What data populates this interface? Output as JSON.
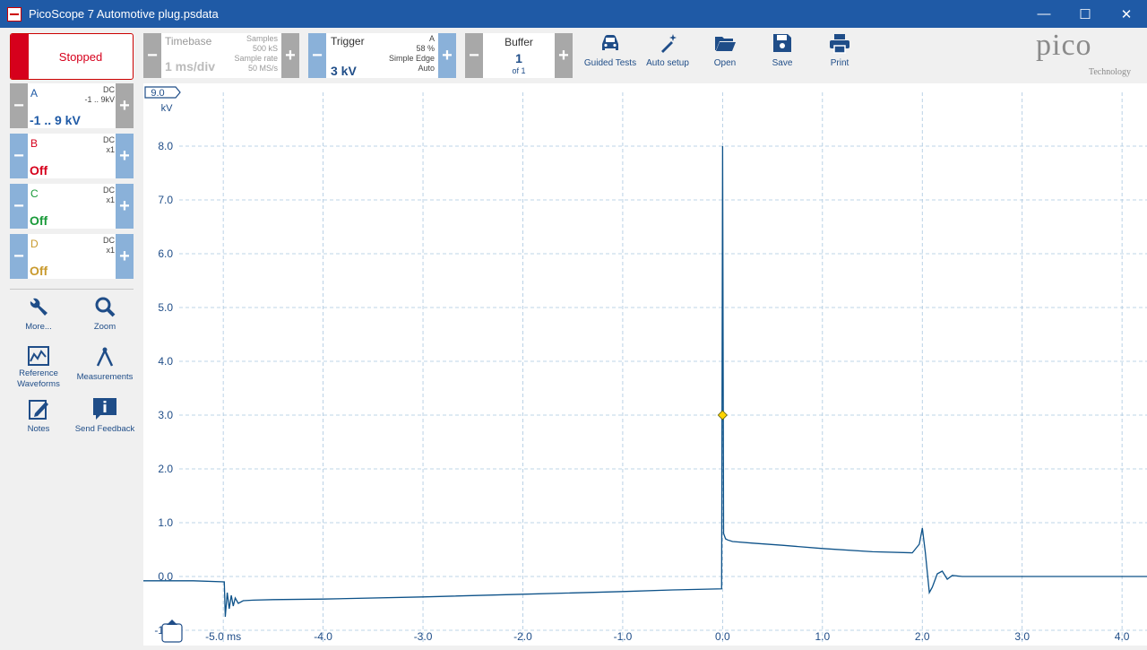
{
  "window": {
    "title": "PicoScope 7 Automotive plug.psdata",
    "minimize": "—",
    "maximize": "☐",
    "close": "✕"
  },
  "toolbar": {
    "run_state": "Stopped",
    "timebase": {
      "label": "Timebase",
      "value": "1 ms/div",
      "samples_label": "Samples",
      "samples": "500 kS",
      "rate_label": "Sample rate",
      "rate": "50 MS/s",
      "minus": "−",
      "plus": "+"
    },
    "trigger": {
      "label": "Trigger",
      "value": "3 kV",
      "channel": "A",
      "percent": "58 %",
      "type": "Simple Edge",
      "mode": "Auto",
      "minus": "−",
      "plus": "+"
    },
    "buffer": {
      "label": "Buffer",
      "value": "1",
      "of": "of 1",
      "minus": "−",
      "plus": "+"
    },
    "buttons": {
      "guided": "Guided Tests",
      "auto": "Auto setup",
      "open": "Open",
      "save": "Save",
      "print": "Print"
    },
    "logo": {
      "name": "pico",
      "sub": "Technology"
    }
  },
  "channels": [
    {
      "name": "A",
      "coupling": "DC",
      "probe": "-1 .. 9kV",
      "range": "-1 .. 9 kV",
      "color": "#1f5aa6"
    },
    {
      "name": "B",
      "coupling": "DC",
      "probe": "x1",
      "range": "Off",
      "color": "#d6001c"
    },
    {
      "name": "C",
      "coupling": "DC",
      "probe": "x1",
      "range": "Off",
      "color": "#1a9a3a"
    },
    {
      "name": "D",
      "coupling": "DC",
      "probe": "x1",
      "range": "Off",
      "color": "#c99a2e"
    }
  ],
  "tools": {
    "more": "More...",
    "zoom": "Zoom",
    "reference": "Reference Waveforms",
    "measurements": "Measurements",
    "notes": "Notes",
    "feedback": "Send Feedback"
  },
  "plot": {
    "y_top_label": "9.0",
    "y_unit": "kV",
    "x_first_unit": "ms",
    "trace_color": "#0d5289",
    "trigger_level_kv": 3.0
  },
  "chart_data": {
    "type": "line",
    "title": "",
    "xlabel": "",
    "ylabel": "kV",
    "xlim": [
      -5.8,
      4.25
    ],
    "ylim": [
      -1.0,
      9.0
    ],
    "x_ticks": [
      -5.0,
      -4.0,
      -3.0,
      -2.0,
      -1.0,
      0.0,
      1.0,
      2.0,
      3.0,
      4.0
    ],
    "y_ticks": [
      -1.0,
      0.0,
      1.0,
      2.0,
      3.0,
      4.0,
      5.0,
      6.0,
      7.0,
      8.0
    ],
    "x_tick_labels": [
      "-5.0 ms",
      "-4.0",
      "-3.0",
      "-2.0",
      "-1.0",
      "0.0",
      "1.0",
      "2.0",
      "3.0",
      "4.0"
    ],
    "y_tick_labels": [
      "-1.0",
      "0.0",
      "1.0",
      "2.0",
      "3.0",
      "4.0",
      "5.0",
      "6.0",
      "7.0",
      "8.0"
    ],
    "grid": true,
    "series": [
      {
        "name": "A",
        "x": [
          -5.8,
          -5.3,
          -4.99,
          -4.98,
          -4.96,
          -4.94,
          -4.92,
          -4.9,
          -4.88,
          -4.85,
          -4.8,
          -4.7,
          -4.5,
          -4.0,
          -3.0,
          -2.0,
          -1.0,
          -0.5,
          -0.01,
          0.0,
          0.01,
          0.03,
          0.05,
          0.1,
          0.3,
          0.6,
          1.0,
          1.5,
          1.9,
          1.97,
          2.0,
          2.03,
          2.07,
          2.1,
          2.15,
          2.2,
          2.25,
          2.3,
          2.4,
          3.0,
          4.0,
          4.25
        ],
        "y": [
          -0.08,
          -0.08,
          -0.1,
          -0.75,
          -0.3,
          -0.6,
          -0.35,
          -0.55,
          -0.4,
          -0.5,
          -0.45,
          -0.44,
          -0.43,
          -0.42,
          -0.38,
          -0.33,
          -0.28,
          -0.25,
          -0.23,
          8.0,
          0.8,
          0.7,
          0.68,
          0.65,
          0.62,
          0.58,
          0.52,
          0.46,
          0.44,
          0.6,
          0.9,
          0.45,
          -0.3,
          -0.2,
          0.05,
          0.1,
          -0.05,
          0.02,
          0.0,
          0.0,
          0.0,
          0.0
        ]
      }
    ],
    "trigger_marker": {
      "x": 0.0,
      "y": 3.0
    }
  }
}
